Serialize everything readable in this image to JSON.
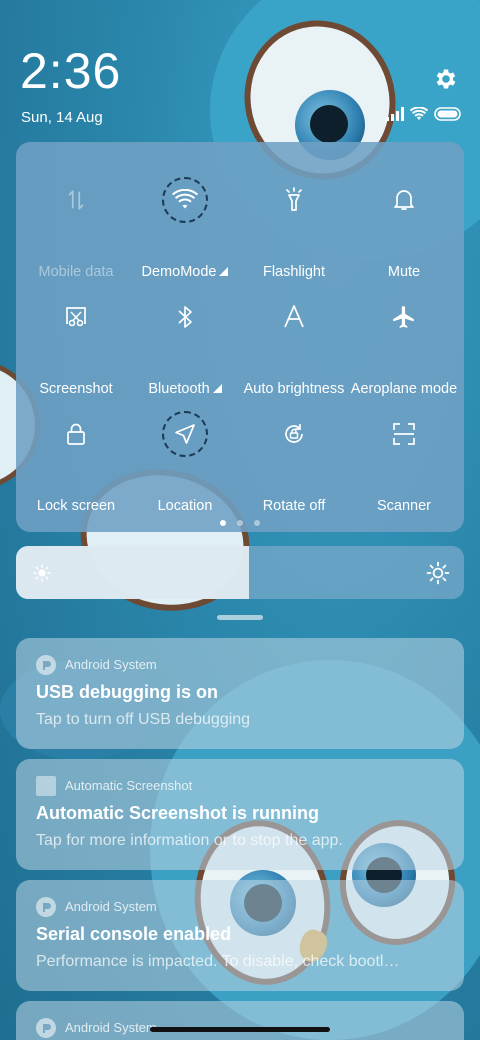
{
  "status": {
    "time": "2:36",
    "date": "Sun, 14 Aug"
  },
  "quick_settings": {
    "tiles": [
      {
        "label": "Mobile data",
        "icon": "mobile-data-icon",
        "active": false,
        "disabled": true,
        "expandable": false
      },
      {
        "label": "DemoMode",
        "icon": "wifi-icon",
        "active": true,
        "disabled": false,
        "expandable": true
      },
      {
        "label": "Flashlight",
        "icon": "flashlight-icon",
        "active": false,
        "disabled": false,
        "expandable": false
      },
      {
        "label": "Mute",
        "icon": "bell-icon",
        "active": false,
        "disabled": false,
        "expandable": false
      },
      {
        "label": "Screenshot",
        "icon": "screenshot-icon",
        "active": false,
        "disabled": false,
        "expandable": false
      },
      {
        "label": "Bluetooth",
        "icon": "bluetooth-icon",
        "active": false,
        "disabled": false,
        "expandable": true
      },
      {
        "label": "Auto brightness",
        "icon": "auto-brightness-icon",
        "active": false,
        "disabled": false,
        "expandable": false
      },
      {
        "label": "Aeroplane mode",
        "icon": "airplane-icon",
        "active": false,
        "disabled": false,
        "expandable": false
      },
      {
        "label": "Lock screen",
        "icon": "lock-icon",
        "active": false,
        "disabled": false,
        "expandable": false
      },
      {
        "label": "Location",
        "icon": "location-icon",
        "active": true,
        "disabled": false,
        "expandable": false
      },
      {
        "label": "Rotate off",
        "icon": "rotate-lock-icon",
        "active": false,
        "disabled": false,
        "expandable": false
      },
      {
        "label": "Scanner",
        "icon": "scanner-icon",
        "active": false,
        "disabled": false,
        "expandable": false
      }
    ],
    "page_count": 3,
    "current_page": 1
  },
  "brightness": {
    "level": 0.52
  },
  "notifications": [
    {
      "app": "Android System",
      "icon": "android-system-icon",
      "title": "USB debugging is on",
      "body": "Tap to turn off USB debugging"
    },
    {
      "app": "Automatic Screenshot",
      "icon": "automatic-screenshot-icon",
      "title": "Automatic Screenshot is running",
      "body": "Tap for more information or to stop the app."
    },
    {
      "app": "Android System",
      "icon": "android-system-icon",
      "title": "Serial console enabled",
      "body": "Performance is impacted. To disable, check bootl…"
    },
    {
      "app": "Android System",
      "icon": "android-system-icon",
      "title": "",
      "body": ""
    }
  ],
  "colors": {
    "panel": "#70a0c4",
    "active_ring": "#1d3a56",
    "wallpaper": "#2f86a8"
  }
}
